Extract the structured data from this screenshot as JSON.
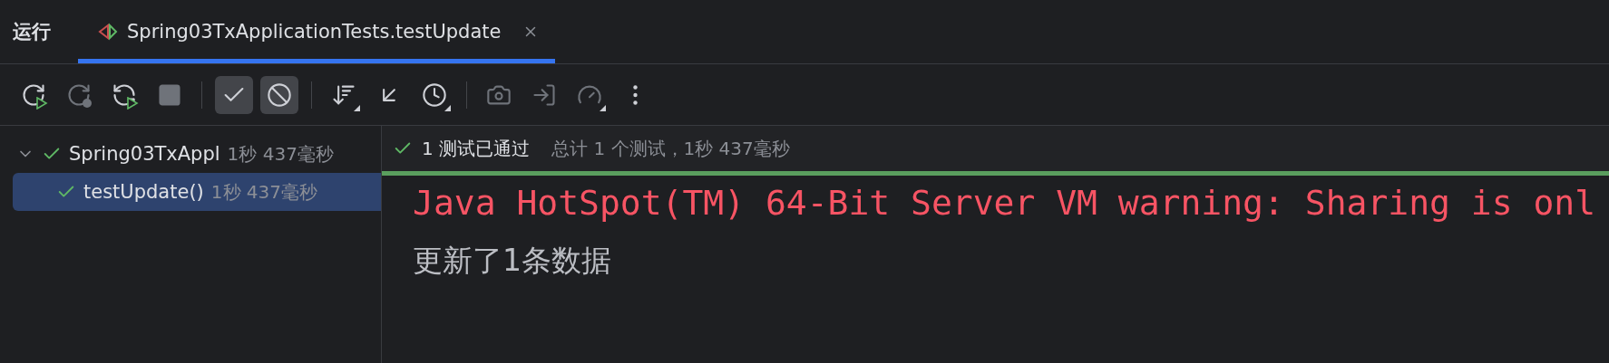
{
  "header": {
    "title": "运行",
    "tabs": [
      {
        "label": "Spring03TxApplicationTests.testUpdate",
        "selected": true
      }
    ]
  },
  "toolbar": [
    {
      "kind": "rerun",
      "disabled": false
    },
    {
      "kind": "rerun-failed",
      "disabled": true
    },
    {
      "kind": "auto-rerun",
      "disabled": false
    },
    {
      "kind": "stop",
      "disabled": true
    },
    {
      "kind": "separator"
    },
    {
      "kind": "show-passed",
      "on": true
    },
    {
      "kind": "show-ignored",
      "on": true
    },
    {
      "kind": "separator"
    },
    {
      "kind": "sort",
      "disabled": false
    },
    {
      "kind": "collapse",
      "disabled": false
    },
    {
      "kind": "history",
      "disabled": false
    },
    {
      "kind": "separator"
    },
    {
      "kind": "snapshot",
      "disabled": true
    },
    {
      "kind": "import",
      "disabled": true
    },
    {
      "kind": "profile",
      "disabled": true
    },
    {
      "kind": "more",
      "disabled": false
    }
  ],
  "tree": [
    {
      "label": "Spring03TxAppl",
      "time": "1秒 437毫秒",
      "passed": true,
      "expanded": true,
      "selected": false,
      "children": [
        {
          "label": "testUpdate()",
          "time": "1秒 437毫秒",
          "passed": true,
          "selected": true
        }
      ]
    }
  ],
  "status": {
    "summary": "1 测试已通过",
    "detail": "总计 1 个测试，1秒 437毫秒",
    "passed": true,
    "level": 1
  },
  "console": [
    {
      "kind": "error",
      "text": "Java HotSpot(TM) 64-Bit Server VM warning: Sharing is onl"
    },
    {
      "kind": "output",
      "text": "更新了1条数据"
    }
  ]
}
